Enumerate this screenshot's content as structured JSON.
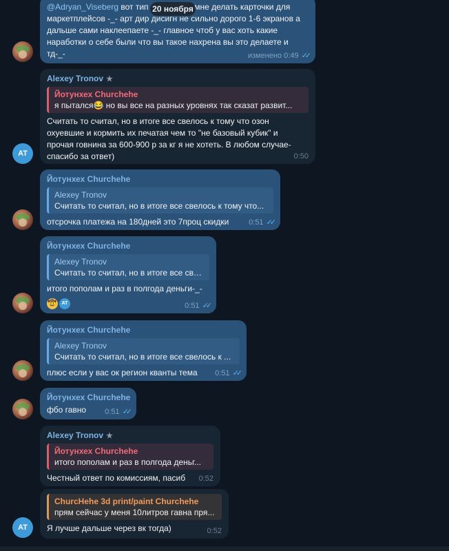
{
  "date_pill": "20 ноября",
  "colors": {
    "background": "#0e1621",
    "outgoing_bubble": "#2b5278",
    "incoming_bubble": "#182533",
    "accent": "#6aa9e8"
  },
  "icons": {
    "read_receipt": "double-check-icon",
    "admin_badge": "star-icon"
  },
  "messages": [
    {
      "text_mention": "@Adryan_Viseberg",
      "text": "вот тип ... мне делать карточки для маркетплейсов -_- арт дир дисигн не сильно дорого 1-6 экранов а дальше сами наклеепаете -_- главное чтоб у вас хоть какие наработки о себе были что вы такое нахрена вы это делаете и тд-_-",
      "line1_start": "вот тип",
      "line1_end": "мне делать карточки для",
      "line2": "маркетплейсов -_- арт дир дисигн не сильно дорого 1-6 экранов а",
      "line3": "дальше сами наклеепаете -_- главное чтоб у вас хоть какие",
      "line4": "наработки о себе были что вы такое нахрена вы это делаете и",
      "line5": "тд-_-",
      "time": "изменено 0:49"
    },
    {
      "sender": "Alexey Tronov",
      "reply_name": "Йотунхех Churchehe",
      "reply_text": "я пытался😂 но вы все на разных уровнях так сказат развит...",
      "line1": "Считать то считал, но в итоге все свелось к тому что озон",
      "line2": "охуевшие и кормить их печатая чем то \"не базовый кубик\" и",
      "line3": "прочая говнина за 600-900 р за кг я не хотеть. В любом случае-",
      "line4": "спасибо за ответ)",
      "time": "0:50",
      "avatar": "AT"
    },
    {
      "sender": "Йотунхех Churchehe",
      "reply_name": "Alexey Tronov",
      "reply_text": "Считать то считал, но в итоге все свелось к тому что...",
      "text": "отсрочка платежа на 180дней это 7проц скидки",
      "time": "0:51"
    },
    {
      "sender": "Йотунхех Churchehe",
      "reply_name": "Alexey Tronov",
      "reply_text": "Считать то считал, но в итоге все све...",
      "text": "итого пополам и раз в полгода деньги-_-",
      "time": "0:51",
      "reaction_emoji": "🤠",
      "reaction_avatar": "AT"
    },
    {
      "sender": "Йотунхех Churchehe",
      "reply_name": "Alexey Tronov",
      "reply_text": "Считать то считал, но в итоге все свелось к ...",
      "text": "плюс если у вас ок регион кванты тема",
      "time": "0:51"
    },
    {
      "sender": "Йотунхех Churchehe",
      "text": "фбо гавно",
      "time": "0:51"
    },
    {
      "sender": "Alexey Tronov",
      "reply_name": "Йотунхех Churchehe",
      "reply_text": "итого пополам и раз в полгода деньг...",
      "text": "Честный ответ по комиссиям, пасиб",
      "time": "0:52"
    },
    {
      "reply_name": "ChurcHehe 3d print/paint Churchehe",
      "reply_text": "прям сейчас у меня 10литров гавна пря...",
      "text": "Я лучше дальше через вк тогда)",
      "time": "0:52",
      "avatar": "AT"
    }
  ]
}
